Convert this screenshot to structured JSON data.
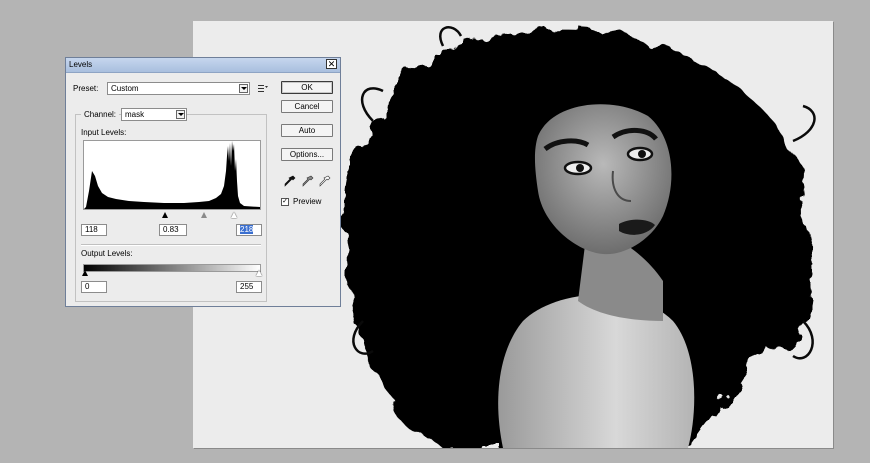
{
  "dialog": {
    "title": "Levels",
    "preset_label": "Preset:",
    "preset_value": "Custom",
    "channel_label": "Channel:",
    "channel_value": "mask",
    "input_levels_label": "Input Levels:",
    "output_levels_label": "Output Levels:",
    "input_black": "118",
    "input_gamma": "0.83",
    "input_white": "218",
    "output_black": "0",
    "output_white": "255",
    "preview_label": "Preview",
    "preview_checked": true,
    "close_glyph": "✕"
  },
  "buttons": {
    "ok": "OK",
    "cancel": "Cancel",
    "auto": "Auto",
    "options": "Options..."
  },
  "icons": [
    "preset-options-icon",
    "black-eyedropper-icon",
    "gray-eyedropper-icon",
    "white-eyedropper-icon",
    "close-icon",
    "checkbox-check-icon"
  ]
}
